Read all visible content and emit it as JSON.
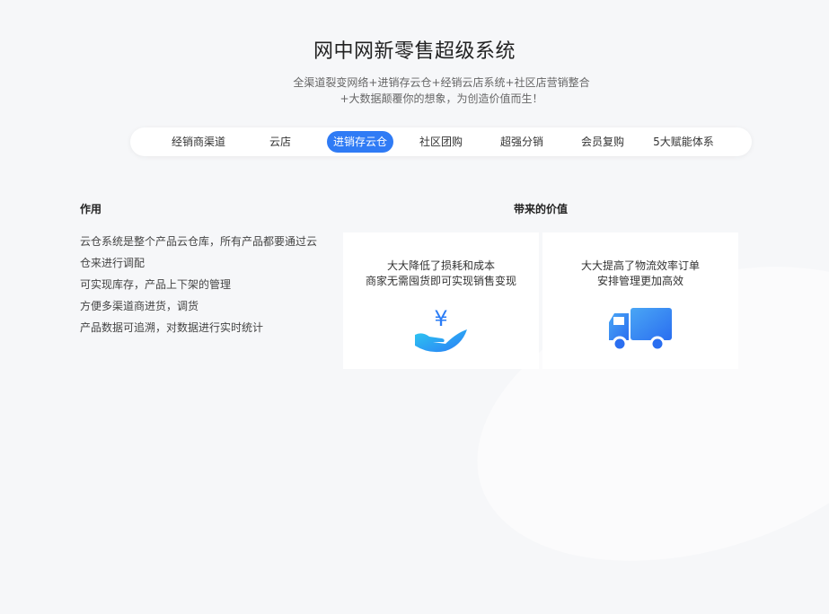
{
  "header": {
    "title": "网中网新零售超级系统",
    "subtitle_line1": "全渠道裂变网络+进销存云仓+经销云店系统+社区店营销整合",
    "subtitle_line2": "+大数据颠覆你的想象，为创造价值而生！"
  },
  "tabs": [
    {
      "label": "经销商渠道"
    },
    {
      "label": "云店"
    },
    {
      "label": "进销存云仓",
      "active": true
    },
    {
      "label": "社区团购"
    },
    {
      "label": "超强分销"
    },
    {
      "label": "会员复购"
    },
    {
      "label": "5大赋能体系"
    }
  ],
  "left": {
    "heading": "作用",
    "lines": [
      "云仓系统是整个产品云仓库，所有产品都要通过云",
      "仓来进行调配",
      "可实现库存，产品上下架的管理",
      "方便多渠道商进货，调货",
      "产品数据可追溯，对数据进行实时统计"
    ]
  },
  "right": {
    "heading": "带来的价值",
    "cards": [
      {
        "line1": "大大降低了损耗和成本",
        "line2": "商家无需囤货即可实现销售变现",
        "icon": "yuan-hand-icon"
      },
      {
        "line1": "大大提高了物流效率订单",
        "line2": "安排管理更加高效",
        "icon": "truck-icon"
      }
    ]
  },
  "colors": {
    "accent": "#2f7bf5",
    "icon_gradient_start": "#2ec9f0",
    "icon_gradient_end": "#2a7cf6"
  }
}
